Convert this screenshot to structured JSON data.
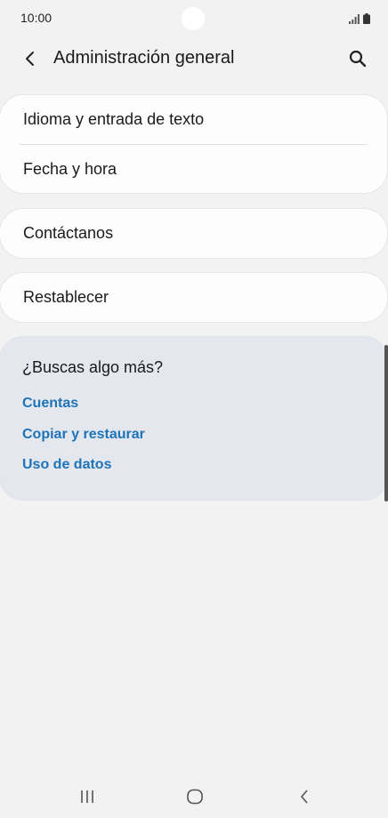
{
  "status_bar": {
    "time": "10:00"
  },
  "header": {
    "title": "Administración general",
    "back_icon": "chevron-left-icon",
    "search_icon": "search-icon"
  },
  "groups": [
    {
      "items": [
        {
          "label": "Idioma y entrada de texto"
        },
        {
          "label": "Fecha y hora"
        }
      ]
    },
    {
      "items": [
        {
          "label": "Contáctanos"
        }
      ]
    },
    {
      "items": [
        {
          "label": "Restablecer"
        }
      ]
    }
  ],
  "suggestions": {
    "title": "¿Buscas algo más?",
    "links": [
      {
        "label": "Cuentas"
      },
      {
        "label": "Copiar y restaurar"
      },
      {
        "label": "Uso de datos"
      }
    ],
    "background": "#e4e8ee",
    "link_color": "#1f73b7"
  },
  "nav_bar": {
    "recent_icon": "recent-apps-icon",
    "home_icon": "home-icon",
    "back_icon": "back-icon"
  }
}
